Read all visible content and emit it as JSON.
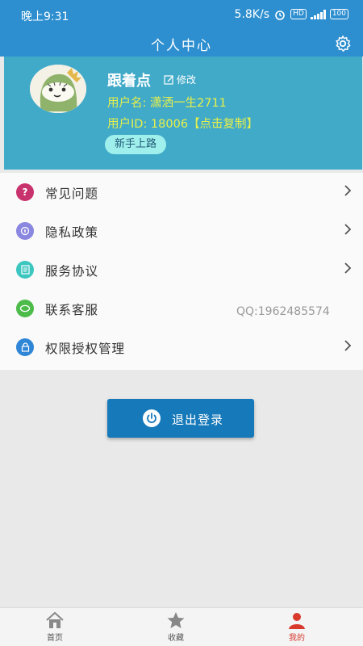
{
  "status_bar": {
    "time": "晚上9:31",
    "speed": "5.8K/s",
    "battery": "100"
  },
  "header": {
    "title": "个人中心",
    "settings_icon": "gear-icon"
  },
  "profile": {
    "nickname": "跟着点",
    "edit_label": "修改",
    "username_line": "用户名: 潇洒一生2711",
    "userid_line": "用户ID: 18006【点击复制】",
    "badge": "新手上路"
  },
  "menu": {
    "items": [
      {
        "label": "常见问题",
        "icon": "question-icon",
        "color": "#c8336e"
      },
      {
        "label": "隐私政策",
        "icon": "compass-icon",
        "color": "#8a87e0"
      },
      {
        "label": "服务协议",
        "icon": "document-icon",
        "color": "#3cc6c0"
      },
      {
        "label": "联系客服",
        "icon": "chat-icon",
        "color": "#4dbb4a"
      },
      {
        "label": "权限授权管理",
        "icon": "lock-icon",
        "color": "#2f86d6"
      }
    ],
    "contact_qq": "QQ:1962485574"
  },
  "logout": {
    "label": "退出登录"
  },
  "tabbar": {
    "tabs": [
      {
        "label": "首页",
        "icon": "home-icon"
      },
      {
        "label": "收藏",
        "icon": "star-icon"
      },
      {
        "label": "我的",
        "icon": "user-icon"
      }
    ],
    "active_color": "#d83a2e"
  }
}
